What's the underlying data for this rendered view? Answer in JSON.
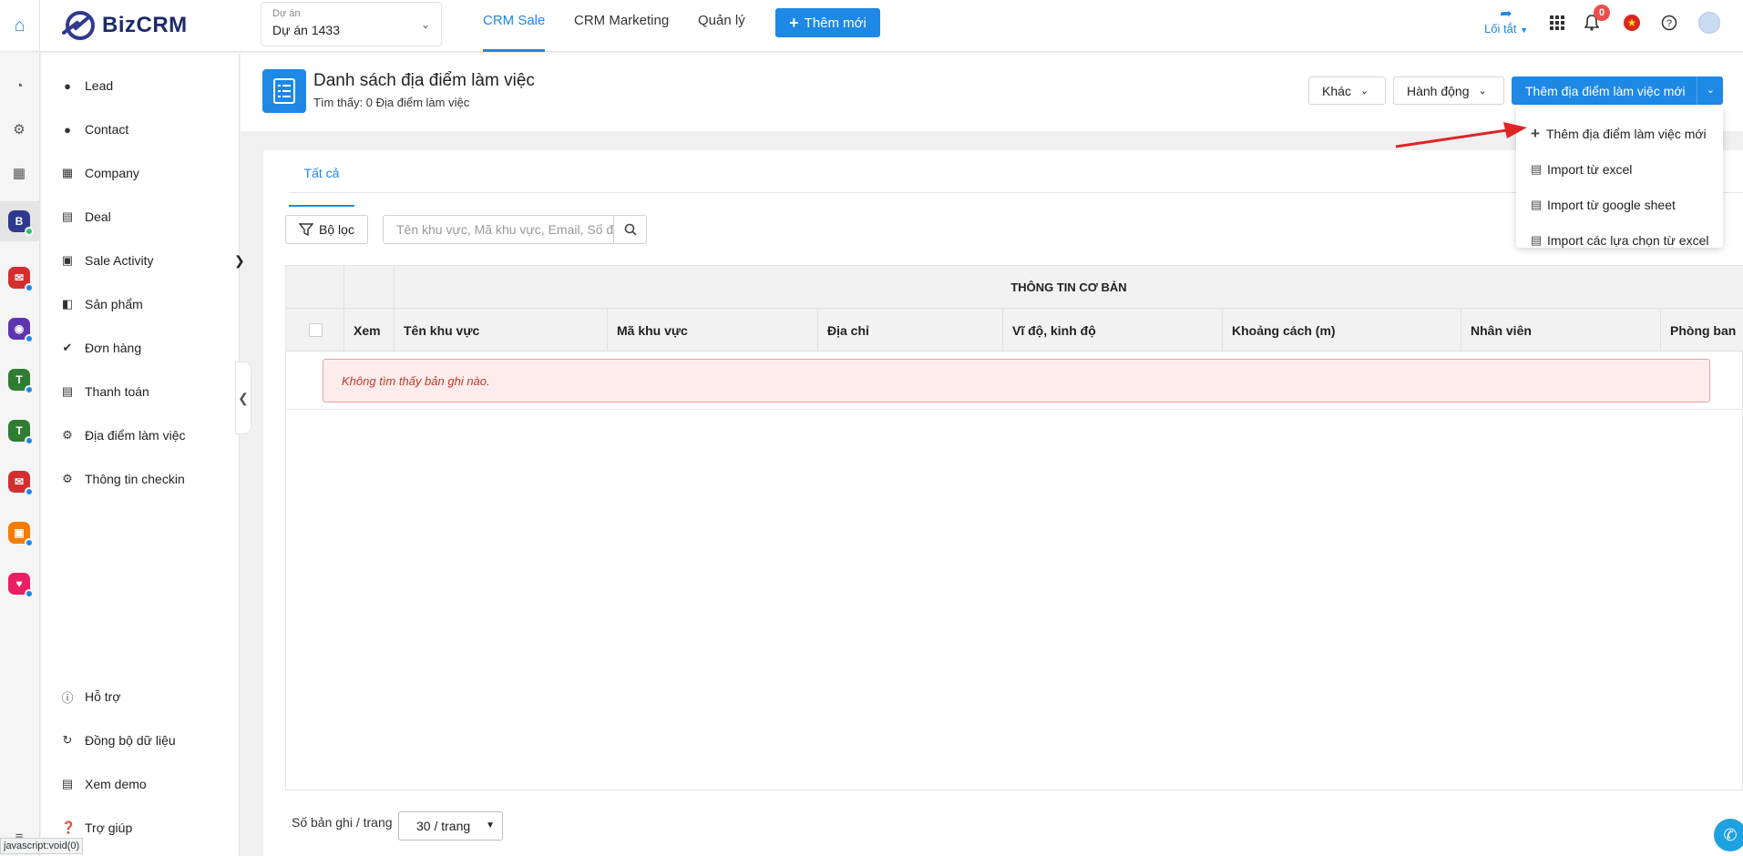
{
  "topbar": {
    "logo_text": "BizCRM",
    "project_label": "Dự án",
    "project_value": "Dự án 1433",
    "nav_tabs": [
      "CRM Sale",
      "CRM Marketing",
      "Quản lý"
    ],
    "add_new_label": "Thêm mới",
    "shortcut_label": "Lối tắt",
    "notification_count": "0"
  },
  "sidebar": {
    "items": [
      {
        "label": "Lead",
        "icon": "person-icon"
      },
      {
        "label": "Contact",
        "icon": "person-icon"
      },
      {
        "label": "Company",
        "icon": "building-icon"
      },
      {
        "label": "Deal",
        "icon": "document-icon"
      },
      {
        "label": "Sale Activity",
        "icon": "calendar-icon"
      },
      {
        "label": "Sản phẩm",
        "icon": "book-icon"
      },
      {
        "label": "Đơn hàng",
        "icon": "cart-icon"
      },
      {
        "label": "Thanh toán",
        "icon": "ledger-icon"
      },
      {
        "label": "Địa điểm làm việc",
        "icon": "gear-icon"
      },
      {
        "label": "Thông tin checkin",
        "icon": "gear-icon"
      }
    ],
    "bottom_items": [
      {
        "label": "Hỗ trợ",
        "icon": "info-icon"
      },
      {
        "label": "Đồng bộ dữ liệu",
        "icon": "sync-icon"
      },
      {
        "label": "Xem demo",
        "icon": "demo-icon"
      },
      {
        "label": "Trợ giúp",
        "icon": "help-icon"
      }
    ]
  },
  "page": {
    "title": "Danh sách địa điểm làm việc",
    "subtitle": "Tìm thấy: 0 Địa điểm làm việc",
    "btn_other": "Khác",
    "btn_action": "Hành động",
    "btn_primary": "Thêm địa điểm làm việc mới"
  },
  "dropdown": {
    "items": [
      "Thêm địa điểm làm việc mới",
      "Import từ excel",
      "Import từ google sheet",
      "Import các lựa chọn từ excel"
    ]
  },
  "content": {
    "tab_all": "Tất cả",
    "filter_label": "Bộ lọc",
    "search_placeholder": "Tên khu vực, Mã khu vực, Email, Số điện thoại",
    "group_header": "THÔNG TIN CƠ BẢN",
    "columns": [
      "Xem",
      "Tên khu vực",
      "Mã khu vực",
      "Địa chỉ",
      "Vĩ độ, kinh độ",
      "Khoảng cách (m)",
      "Nhân viên",
      "Phòng ban"
    ],
    "empty_message": "Không tìm thấy bản ghi nào.",
    "pager_label": "Số bản ghi / trang",
    "pager_value": "30 / trang"
  },
  "status_bar_text": "javascript:void(0)",
  "colors": {
    "primary": "#1e88e5",
    "alert_bg": "#fdecec",
    "alert_text": "#c0392b",
    "arrow": "#e02424"
  }
}
